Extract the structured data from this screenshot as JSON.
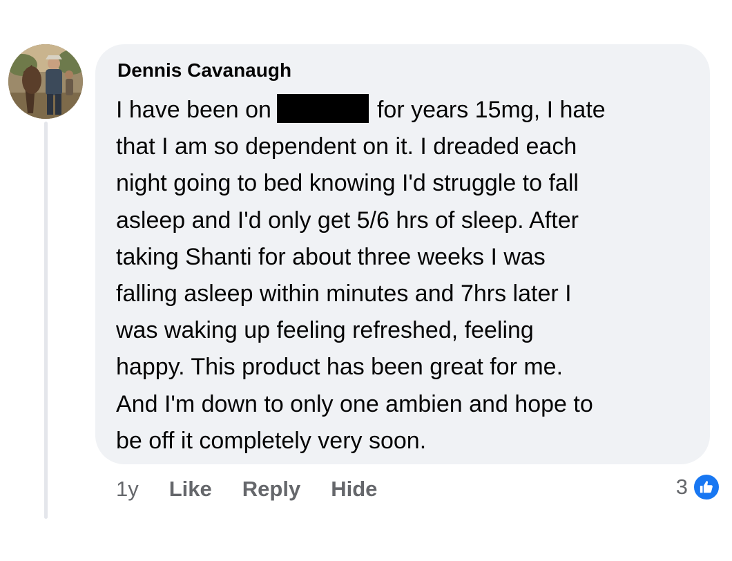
{
  "comment": {
    "author": "Dennis Cavanaugh",
    "body_lines": [
      [
        "I have been on",
        "for years 15mg, I hate"
      ],
      "that I am so dependent on it. I dreaded each",
      "night going to bed knowing I'd struggle to fall",
      "asleep and I'd only get 5/6 hrs of sleep. After",
      "taking Shanti for about three weeks I was",
      "falling asleep within minutes and 7hrs later I",
      "was waking up feeling refreshed, feeling",
      "happy. This product has been great for me.",
      "And I'm down to only one ambien and hope to",
      "be off it completely very soon."
    ]
  },
  "actions": {
    "timestamp": "1y",
    "like": "Like",
    "reply": "Reply",
    "hide": "Hide"
  },
  "reactions": {
    "count": "3",
    "icon": "thumbs-up-icon",
    "badge_color": "#1877f2"
  },
  "colors": {
    "bubble": "#f0f2f5",
    "secondary_text": "#65676b",
    "redaction": "#000000"
  }
}
